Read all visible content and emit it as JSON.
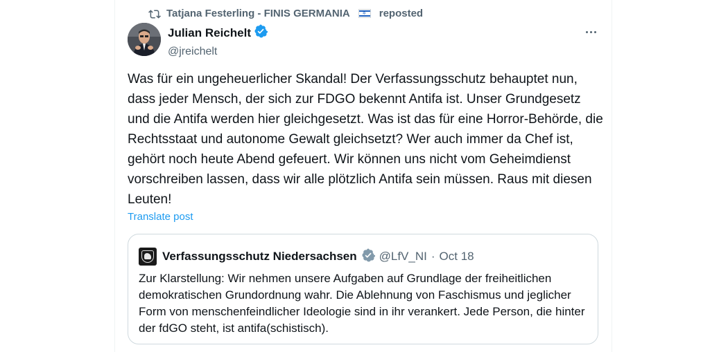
{
  "repost": {
    "name": "Tatjana Festerling - FINIS GERMANIA",
    "suffix": "reposted",
    "flag_icon": "israel-flag"
  },
  "author": {
    "name": "Julian Reichelt",
    "handle": "@jreichelt",
    "verified_color": "#1d9bf0"
  },
  "post": {
    "text": "Was für ein ungeheuerlicher Skandal! Der Verfassungsschutz behauptet nun, dass jeder Mensch, der sich zur FDGO bekennt Antifa ist. Unser Grundgesetz und die Antifa werden hier gleichgesetzt. Was ist das für eine Horror-Behörde, die Rechtsstaat und autonome Gewalt gleichsetzt? Wer auch immer da Chef ist, gehört noch heute Abend gefeuert. Wir können uns nicht vom Geheimdienst vorschreiben lassen, dass wir alle plötzlich Antifa sein müssen. Raus mit diesen Leuten!",
    "translate_label": "Translate post"
  },
  "quote": {
    "name": "Verfassungsschutz Niedersachsen",
    "handle": "@LfV_NI",
    "separator": "·",
    "date": "Oct 18",
    "verified_color": "#829aab",
    "text": "Zur Klarstellung: Wir nehmen unsere Aufgaben auf Grundlage der freiheitlichen demokratischen Grundordnung wahr. Die Ablehnung von Faschismus und jeglicher Form von menschenfeindlicher Ideologie sind in ihr verankert. Jede Person, die hinter der fdGO steht, ist antifa(schistisch)."
  },
  "colors": {
    "link": "#1d9bf0",
    "secondary_text": "#536471",
    "border": "#cfd9de"
  }
}
